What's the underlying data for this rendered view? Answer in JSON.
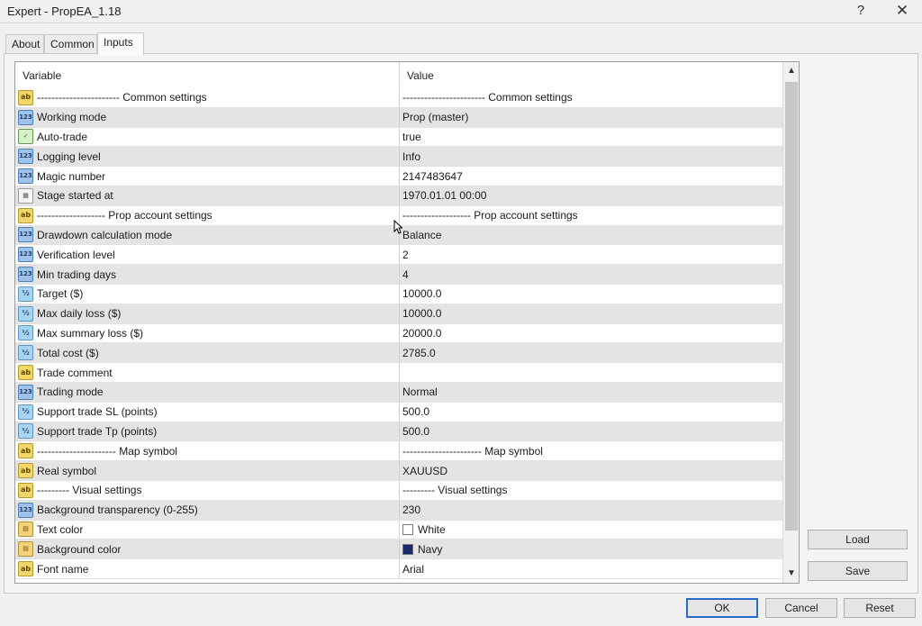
{
  "window": {
    "title": "Expert - PropEA_1.18",
    "help_label": "?",
    "close_label": "✕"
  },
  "tabs": [
    {
      "label": "About",
      "active": false
    },
    {
      "label": "Common",
      "active": false
    },
    {
      "label": "Inputs",
      "active": true
    }
  ],
  "grid": {
    "headers": {
      "variable": "Variable",
      "value": "Value"
    },
    "rows": [
      {
        "type": "ab",
        "icon": "text-type-icon",
        "variable": "----------------------- Common settings",
        "value": "----------------------- Common settings"
      },
      {
        "type": "n123",
        "icon": "integer-type-icon",
        "variable": "Working mode",
        "value": "Prop (master)"
      },
      {
        "type": "bool",
        "icon": "boolean-type-icon",
        "variable": "Auto-trade",
        "value": "true"
      },
      {
        "type": "n123",
        "icon": "integer-type-icon",
        "variable": "Logging level",
        "value": "Info"
      },
      {
        "type": "n123",
        "icon": "integer-type-icon",
        "variable": "Magic number",
        "value": "2147483647"
      },
      {
        "type": "dt",
        "icon": "datetime-type-icon",
        "variable": "Stage started at",
        "value": "1970.01.01 00:00"
      },
      {
        "type": "ab",
        "icon": "text-type-icon",
        "variable": "------------------- Prop account settings",
        "value": "------------------- Prop account settings"
      },
      {
        "type": "n123",
        "icon": "integer-type-icon",
        "variable": "Drawdown calculation mode",
        "value": "Balance"
      },
      {
        "type": "n123",
        "icon": "integer-type-icon",
        "variable": "Verification level",
        "value": "2"
      },
      {
        "type": "n123",
        "icon": "integer-type-icon",
        "variable": "Min trading days",
        "value": "4"
      },
      {
        "type": "half",
        "icon": "double-type-icon",
        "variable": "Target ($)",
        "value": "10000.0"
      },
      {
        "type": "half",
        "icon": "double-type-icon",
        "variable": "Max daily loss ($)",
        "value": "10000.0"
      },
      {
        "type": "half",
        "icon": "double-type-icon",
        "variable": "Max summary loss ($)",
        "value": "20000.0"
      },
      {
        "type": "half",
        "icon": "double-type-icon",
        "variable": "Total cost ($)",
        "value": "2785.0"
      },
      {
        "type": "ab",
        "icon": "text-type-icon",
        "variable": "Trade comment",
        "value": ""
      },
      {
        "type": "n123",
        "icon": "integer-type-icon",
        "variable": "Trading mode",
        "value": "Normal"
      },
      {
        "type": "half",
        "icon": "double-type-icon",
        "variable": "Support trade SL (points)",
        "value": "500.0"
      },
      {
        "type": "half",
        "icon": "double-type-icon",
        "variable": "Support trade Tp (points)",
        "value": "500.0"
      },
      {
        "type": "ab",
        "icon": "text-type-icon",
        "variable": "---------------------- Map symbol",
        "value": "---------------------- Map symbol"
      },
      {
        "type": "ab",
        "icon": "text-type-icon",
        "variable": "Real symbol",
        "value": "XAUUSD"
      },
      {
        "type": "ab",
        "icon": "text-type-icon",
        "variable": "--------- Visual settings",
        "value": "--------- Visual settings"
      },
      {
        "type": "n123",
        "icon": "integer-type-icon",
        "variable": "Background transparency (0-255)",
        "value": "230"
      },
      {
        "type": "clr",
        "icon": "color-type-icon",
        "variable": "Text color",
        "value": "White",
        "swatch": "#ffffff"
      },
      {
        "type": "clr",
        "icon": "color-type-icon",
        "variable": "Background color",
        "value": "Navy",
        "swatch": "#1b2a6b"
      },
      {
        "type": "ab",
        "icon": "text-type-icon",
        "variable": "Font name",
        "value": "Arial"
      }
    ]
  },
  "type_glyphs": {
    "ab": "ab",
    "n123": "123",
    "half": "½",
    "bool": "✓",
    "dt": "▦",
    "clr": "▤"
  },
  "buttons": {
    "load": "Load",
    "save": "Save",
    "ok": "OK",
    "cancel": "Cancel",
    "reset": "Reset"
  },
  "scrollbar": {
    "up_glyph": "▲",
    "down_glyph": "▼"
  }
}
